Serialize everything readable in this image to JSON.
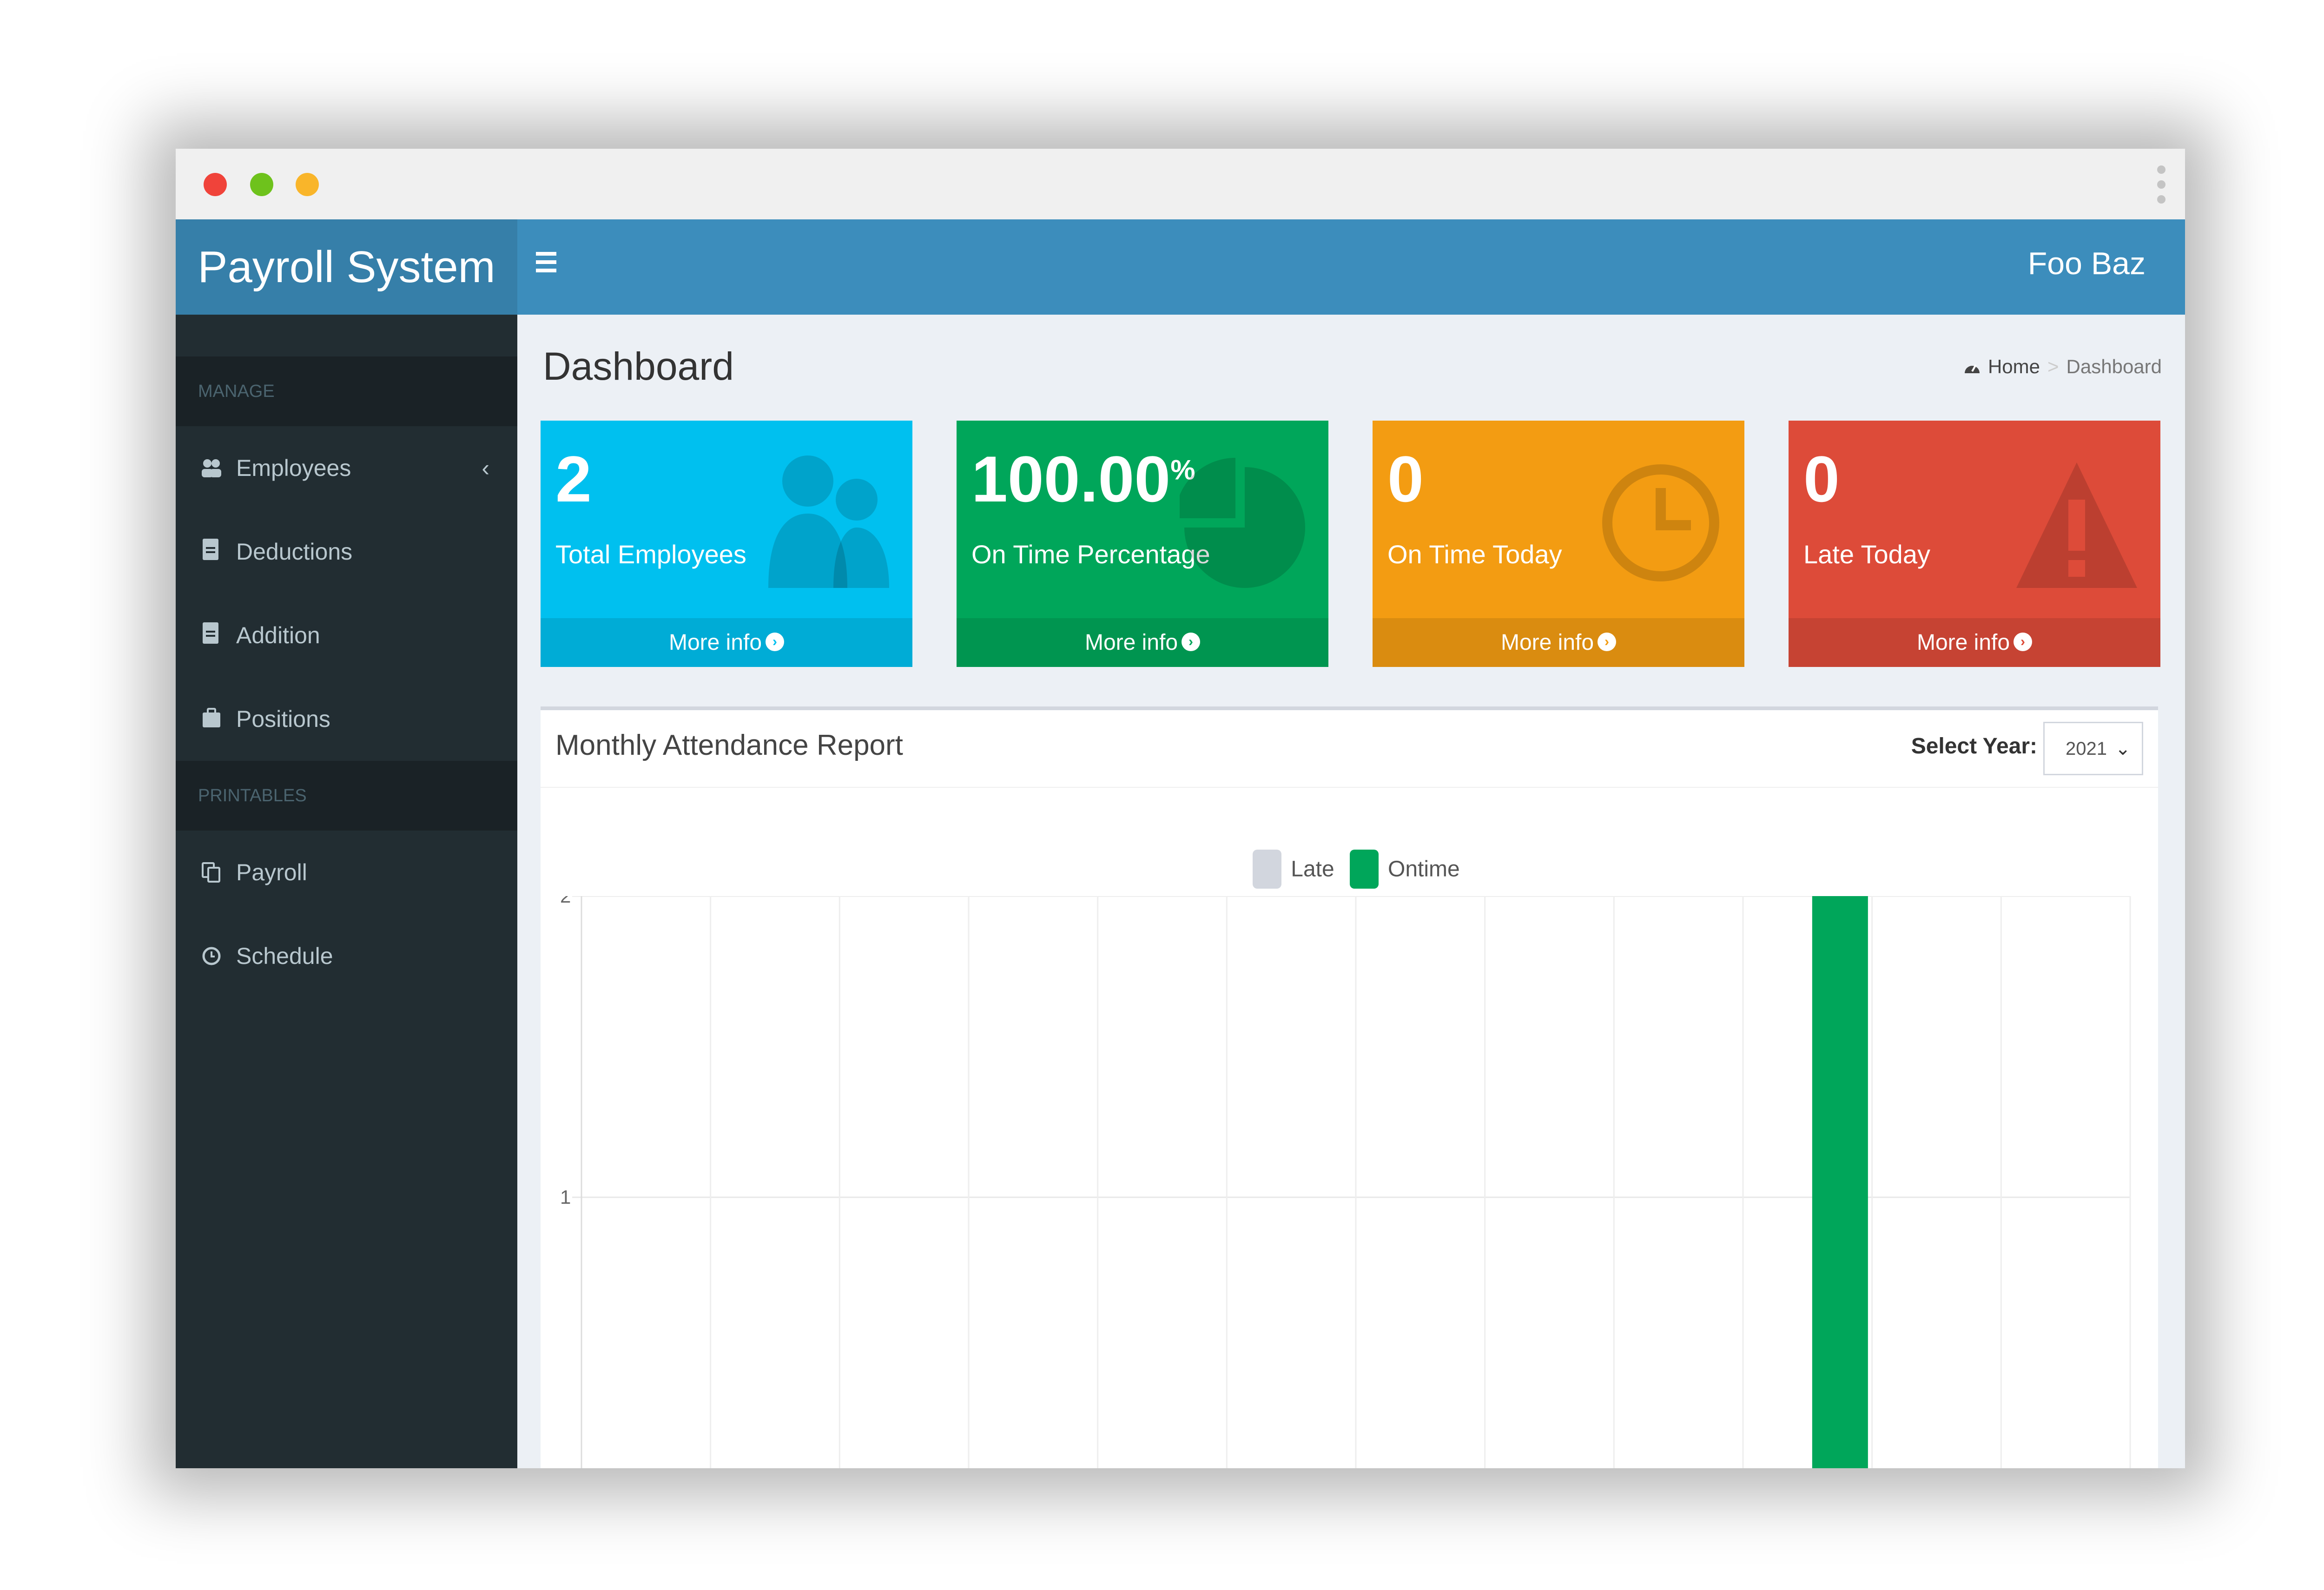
{
  "app": {
    "title": "Payroll System",
    "user": "Foo Baz"
  },
  "sidebar": {
    "sections": [
      {
        "header": "MANAGE",
        "items": [
          {
            "label": "Employees",
            "icon": "users-icon"
          },
          {
            "label": "Deductions",
            "icon": "file-icon"
          },
          {
            "label": "Addition",
            "icon": "file-icon"
          },
          {
            "label": "Positions",
            "icon": "briefcase-icon"
          }
        ]
      },
      {
        "header": "PRINTABLES",
        "items": [
          {
            "label": "Payroll",
            "icon": "copy-icon"
          },
          {
            "label": "Schedule",
            "icon": "clock-icon"
          }
        ]
      }
    ]
  },
  "page": {
    "title": "Dashboard",
    "breadcrumb": [
      "Home",
      "Dashboard"
    ]
  },
  "stat_boxes": [
    {
      "value": "2",
      "suffix": "",
      "label": "Total Employees",
      "link": "More info",
      "color": "#00c0ef",
      "icon": "users-icon"
    },
    {
      "value": "100.00",
      "suffix": "%",
      "label": "On Time Percentage",
      "link": "More info",
      "color": "#00a65a",
      "icon": "pie-chart-icon"
    },
    {
      "value": "0",
      "suffix": "",
      "label": "On Time Today",
      "link": "More info",
      "color": "#f39c12",
      "icon": "clock-icon"
    },
    {
      "value": "0",
      "suffix": "",
      "label": "Late Today",
      "link": "More info",
      "color": "#dd4b39",
      "icon": "warning-icon"
    }
  ],
  "report": {
    "title": "Monthly Attendance Report",
    "select_label": "Select Year:",
    "year": "2021"
  },
  "chart_data": {
    "type": "bar",
    "categories": [
      "",
      "",
      "",
      "",
      "",
      "",
      "",
      "",
      "",
      "",
      "",
      ""
    ],
    "series": [
      {
        "name": "Late",
        "color": "#d2d6de",
        "values": [
          0,
          0,
          0,
          0,
          0,
          0,
          0,
          0,
          0,
          0,
          0,
          0
        ]
      },
      {
        "name": "Ontime",
        "color": "#00a65a",
        "values": [
          0,
          0,
          0,
          0,
          0,
          0,
          0,
          0,
          0,
          2,
          0,
          0
        ]
      }
    ],
    "yticks": [
      1,
      2
    ],
    "ylim": [
      0,
      2.8
    ],
    "legend": "top"
  }
}
